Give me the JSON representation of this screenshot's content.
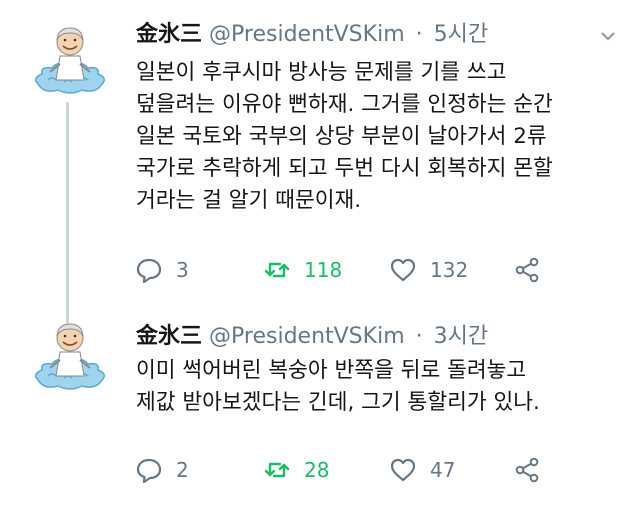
{
  "tweets": [
    {
      "display_name": "金氷三",
      "handle": "@PresidentVSKim",
      "separator": "·",
      "time": "5시간",
      "body_lines": [
        "일본이 후쿠시마 방사능 문제를 기를 쓰고",
        "덮을려는 이유야 뻔하재. 그거를 인정하는 순간",
        "일본 국토와 국부의 상당 부분이 날아가서 2류",
        "국가로 추락하게 되고 두번 다시 회복하지 몬할",
        "거라는 걸 알기 때문이재."
      ],
      "replies": "3",
      "retweets": "118",
      "likes": "132"
    },
    {
      "display_name": "金氷三",
      "handle": "@PresidentVSKim",
      "separator": "·",
      "time": "3시간",
      "body_lines": [
        "이미 썩어버린 복숭아 반쪽을 뒤로 돌려놓고",
        "제값 받아보겠다는 긴데, 그기 통할리가 있나."
      ],
      "replies": "2",
      "retweets": "28",
      "likes": "47"
    }
  ],
  "colors": {
    "text": "#14171a",
    "secondary": "#657786",
    "retweet_green": "#17bf63",
    "thread_line": "#ccd6dd"
  },
  "icons": [
    "avatar-cartoon",
    "chevron-down-icon",
    "reply-icon",
    "retweet-icon",
    "heart-icon",
    "share-icon"
  ]
}
